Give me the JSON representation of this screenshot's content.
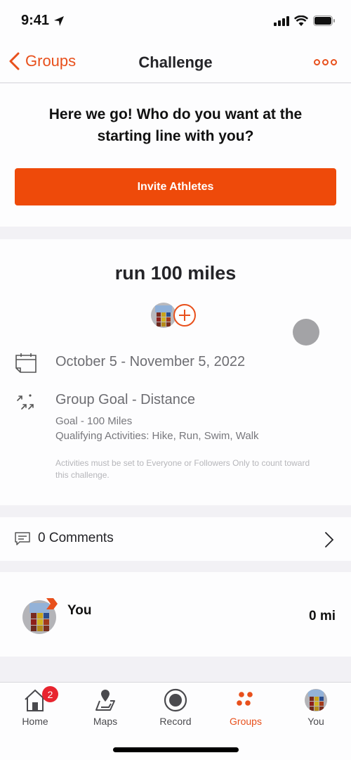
{
  "status_bar": {
    "time": "9:41"
  },
  "nav": {
    "back_label": "Groups",
    "title": "Challenge"
  },
  "invite": {
    "heading": "Here we go! Who do you want at the starting line with you?",
    "button_label": "Invite Athletes"
  },
  "challenge": {
    "title": "run 100 miles",
    "date_range": "October 5 - November 5, 2022",
    "goal_type": "Group Goal - Distance",
    "goal": "Goal - 100 Miles",
    "qualifying_activities": "Qualifying Activities: Hike, Run, Swim, Walk",
    "disclaimer": "Activities must be set to Everyone or Followers Only to count toward this challenge."
  },
  "comments": {
    "label": "0 Comments"
  },
  "leaderboard": [
    {
      "name": "You",
      "distance": "0 mi"
    }
  ],
  "tabs": [
    {
      "label": "Home",
      "icon": "home-icon",
      "badge": "2"
    },
    {
      "label": "Maps",
      "icon": "map-icon"
    },
    {
      "label": "Record",
      "icon": "record-icon"
    },
    {
      "label": "Groups",
      "icon": "groups-icon",
      "active": true
    },
    {
      "label": "You",
      "icon": "profile-avatar"
    }
  ],
  "colors": {
    "accent": "#e8501c",
    "button": "#ee4a0a",
    "badge": "#e8242f"
  }
}
